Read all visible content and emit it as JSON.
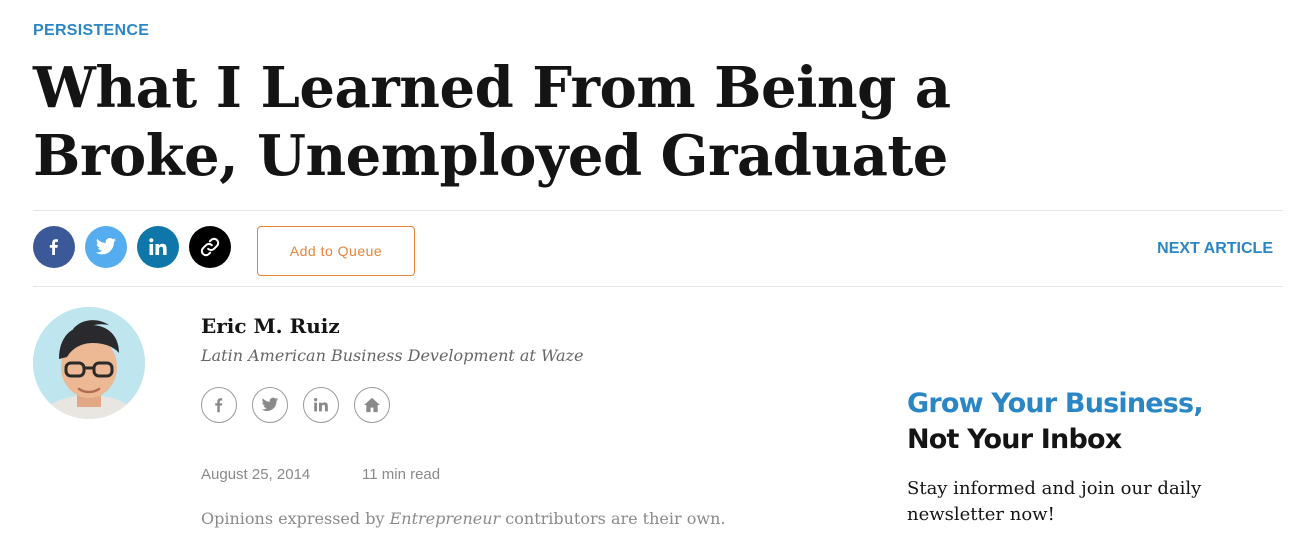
{
  "article": {
    "category": "PERSISTENCE",
    "headline": "What I Learned From Being a Broke, Unemployed Graduate",
    "date": "August 25, 2014",
    "read_time": "11 min read"
  },
  "share_bar": {
    "buttons": [
      {
        "name": "facebook",
        "color": "#3b5998"
      },
      {
        "name": "twitter",
        "color": "#55acee"
      },
      {
        "name": "linkedin",
        "color": "#0e76a8"
      },
      {
        "name": "copy-link",
        "color": "#000000"
      }
    ],
    "queue_label": "Add to Queue",
    "next_label": "NEXT ARTICLE"
  },
  "author": {
    "name": "Eric M. Ruiz",
    "title": "Latin American Business Development at Waze",
    "social_icons": [
      "facebook-icon",
      "twitter-icon",
      "linkedin-icon",
      "home-icon"
    ]
  },
  "disclaimer": {
    "prefix": "Opinions expressed by ",
    "publication": "Entrepreneur",
    "suffix": " contributors are their own."
  },
  "newsletter": {
    "headline_1": "Grow Your Business,",
    "headline_2": "Not Your Inbox",
    "text": "Stay informed and join our daily newsletter now!"
  },
  "colors": {
    "accent": "#2b86c5",
    "queue": "#e8833a",
    "headline": "#141414",
    "meta": "#8a8a8a"
  }
}
